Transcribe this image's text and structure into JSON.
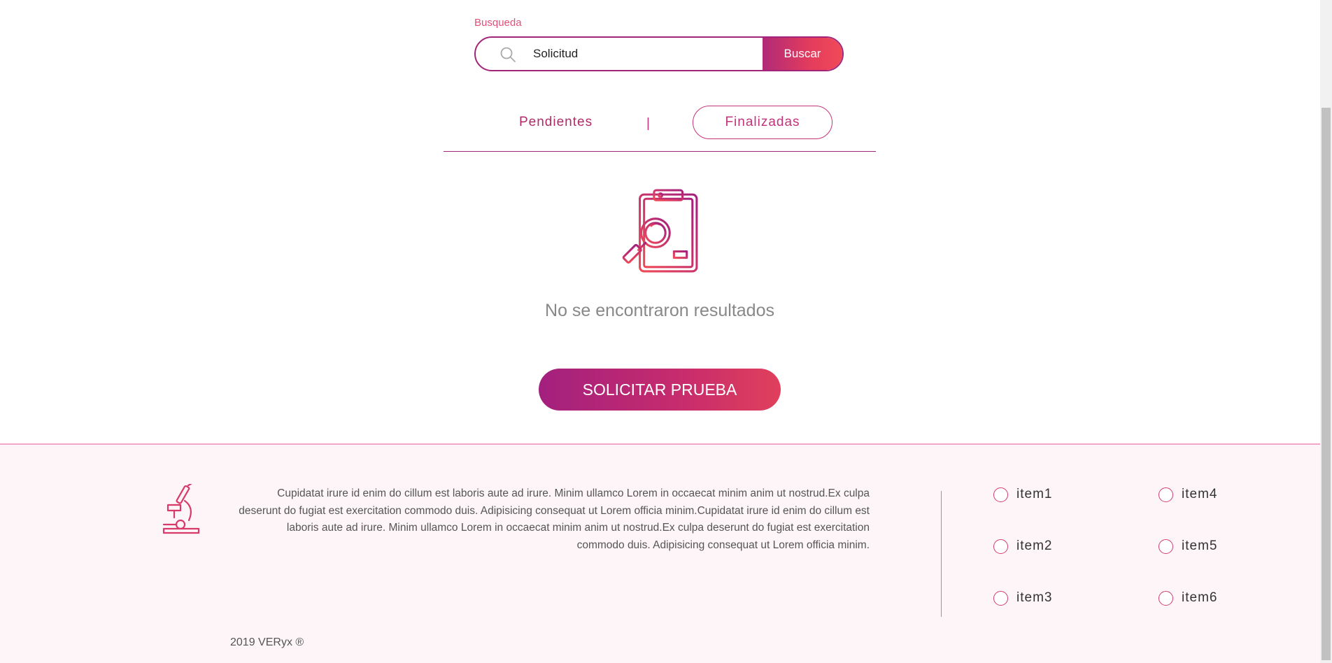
{
  "search": {
    "label": "Busqueda",
    "value": "Solicitud",
    "button_label": "Buscar"
  },
  "tabs": {
    "pending_label": "Pendientes",
    "divider": "|",
    "finished_label": "Finalizadas"
  },
  "empty_state": {
    "message": "No se encontraron resultados",
    "icon": "clipboard-search-icon"
  },
  "cta": {
    "label": "SOLICITAR PRUEBA"
  },
  "footer": {
    "icon": "microscope-icon",
    "text": "Cupidatat irure id enim do cillum est laboris aute ad irure. Minim ullamco Lorem in occaecat minim anim ut nostrud.Ex culpa deserunt do fugiat est exercitation commodo duis. Adipisicing consequat ut Lorem officia minim.Cupidatat irure id enim do cillum est laboris aute ad irure. Minim ullamco Lorem in occaecat minim anim ut nostrud.Ex culpa deserunt do fugiat est exercitation commodo duis. Adipisicing consequat ut Lorem officia minim.",
    "items": [
      "item1",
      "item2",
      "item3",
      "item4",
      "item5",
      "item6"
    ],
    "copyright": "2019 VERyx ®"
  },
  "colors": {
    "accent": "#c2347a",
    "accent_dark": "#a3207e",
    "accent_light": "#f04a58",
    "footer_bg": "#fdf5f8"
  }
}
